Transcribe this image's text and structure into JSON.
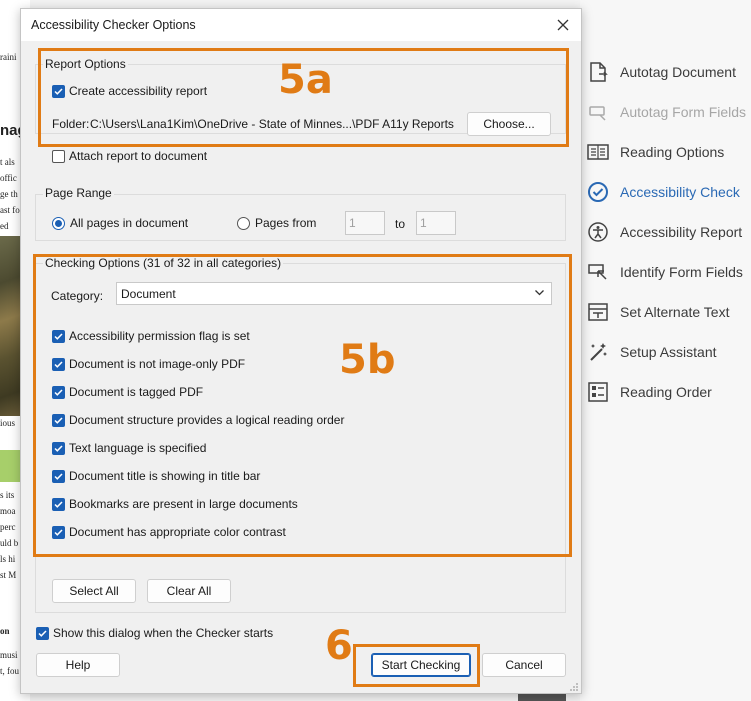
{
  "background_document": {
    "fragments": [
      {
        "text": "raini",
        "cls": ""
      },
      {
        "text": "nag",
        "cls": "big"
      },
      {
        "text": "t als",
        "cls": ""
      },
      {
        "text": "offic",
        "cls": ""
      },
      {
        "text": "ge th",
        "cls": ""
      },
      {
        "text": "ast fo",
        "cls": ""
      },
      {
        "text": "ed",
        "cls": ""
      },
      {
        "text": "ious",
        "cls": ""
      },
      {
        "text": "s its",
        "cls": ""
      },
      {
        "text": "moa",
        "cls": ""
      },
      {
        "text": "perc",
        "cls": ""
      },
      {
        "text": "uld b",
        "cls": ""
      },
      {
        "text": "ls hi",
        "cls": ""
      },
      {
        "text": "st M",
        "cls": ""
      },
      {
        "text": "on",
        "cls": "bold"
      },
      {
        "text": "musi",
        "cls": ""
      },
      {
        "text": "t, fou",
        "cls": ""
      }
    ]
  },
  "tools_panel": {
    "items": [
      {
        "label": "Autotag Document",
        "icon": "autotag-document-icon",
        "state": "normal"
      },
      {
        "label": "Autotag Form Fields",
        "icon": "autotag-form-fields-icon",
        "state": "disabled"
      },
      {
        "label": "Reading Options",
        "icon": "reading-options-icon",
        "state": "normal"
      },
      {
        "label": "Accessibility Check",
        "icon": "accessibility-check-icon",
        "state": "active"
      },
      {
        "label": "Accessibility Report",
        "icon": "accessibility-report-icon",
        "state": "normal"
      },
      {
        "label": "Identify Form Fields",
        "icon": "identify-form-fields-icon",
        "state": "normal"
      },
      {
        "label": "Set Alternate Text",
        "icon": "set-alternate-text-icon",
        "state": "normal"
      },
      {
        "label": "Setup Assistant",
        "icon": "setup-assistant-icon",
        "state": "normal"
      },
      {
        "label": "Reading Order",
        "icon": "reading-order-icon",
        "state": "normal"
      }
    ]
  },
  "dialog": {
    "title": "Accessibility Checker Options",
    "close_icon": "close-icon",
    "report_options": {
      "title": "Report Options",
      "create_report": {
        "label": "Create accessibility report",
        "checked": true
      },
      "folder_label": "Folder:",
      "folder_path": "C:\\Users\\Lana1Kim\\OneDrive - State of Minnes...\\PDF A11y Reports",
      "choose_button": "Choose...",
      "attach_report": {
        "label": "Attach report to document",
        "checked": false
      }
    },
    "page_range": {
      "title": "Page Range",
      "all_pages_label": "All pages in document",
      "pages_from_label": "Pages from",
      "from_value": "1",
      "to_label": "to",
      "to_value": "1",
      "selected": "all"
    },
    "checking_options": {
      "title": "Checking Options (31 of 32 in all categories)",
      "category_label": "Category:",
      "category_value": "Document",
      "checks": [
        {
          "label": "Accessibility permission flag is set",
          "checked": true
        },
        {
          "label": "Document is not image-only PDF",
          "checked": true
        },
        {
          "label": "Document is tagged PDF",
          "checked": true
        },
        {
          "label": "Document structure provides a logical reading order",
          "checked": true
        },
        {
          "label": "Text language is specified",
          "checked": true
        },
        {
          "label": "Document title is showing in title bar",
          "checked": true
        },
        {
          "label": "Bookmarks are present in large documents",
          "checked": true
        },
        {
          "label": "Document has appropriate color contrast",
          "checked": true
        }
      ],
      "select_all_button": "Select All",
      "clear_all_button": "Clear All"
    },
    "show_dialog": {
      "label": "Show this dialog when the Checker starts",
      "checked": true
    },
    "help_button": "Help",
    "start_checking_button": "Start Checking",
    "cancel_button": "Cancel"
  },
  "annotations": {
    "label_5a": "5a",
    "label_5b": "5b",
    "label_6": "6",
    "color": "#e07b15"
  },
  "colors": {
    "accent": "#1a5fb4",
    "active_tool": "#2a69b4",
    "disabled_tool": "#a6a6a6"
  }
}
